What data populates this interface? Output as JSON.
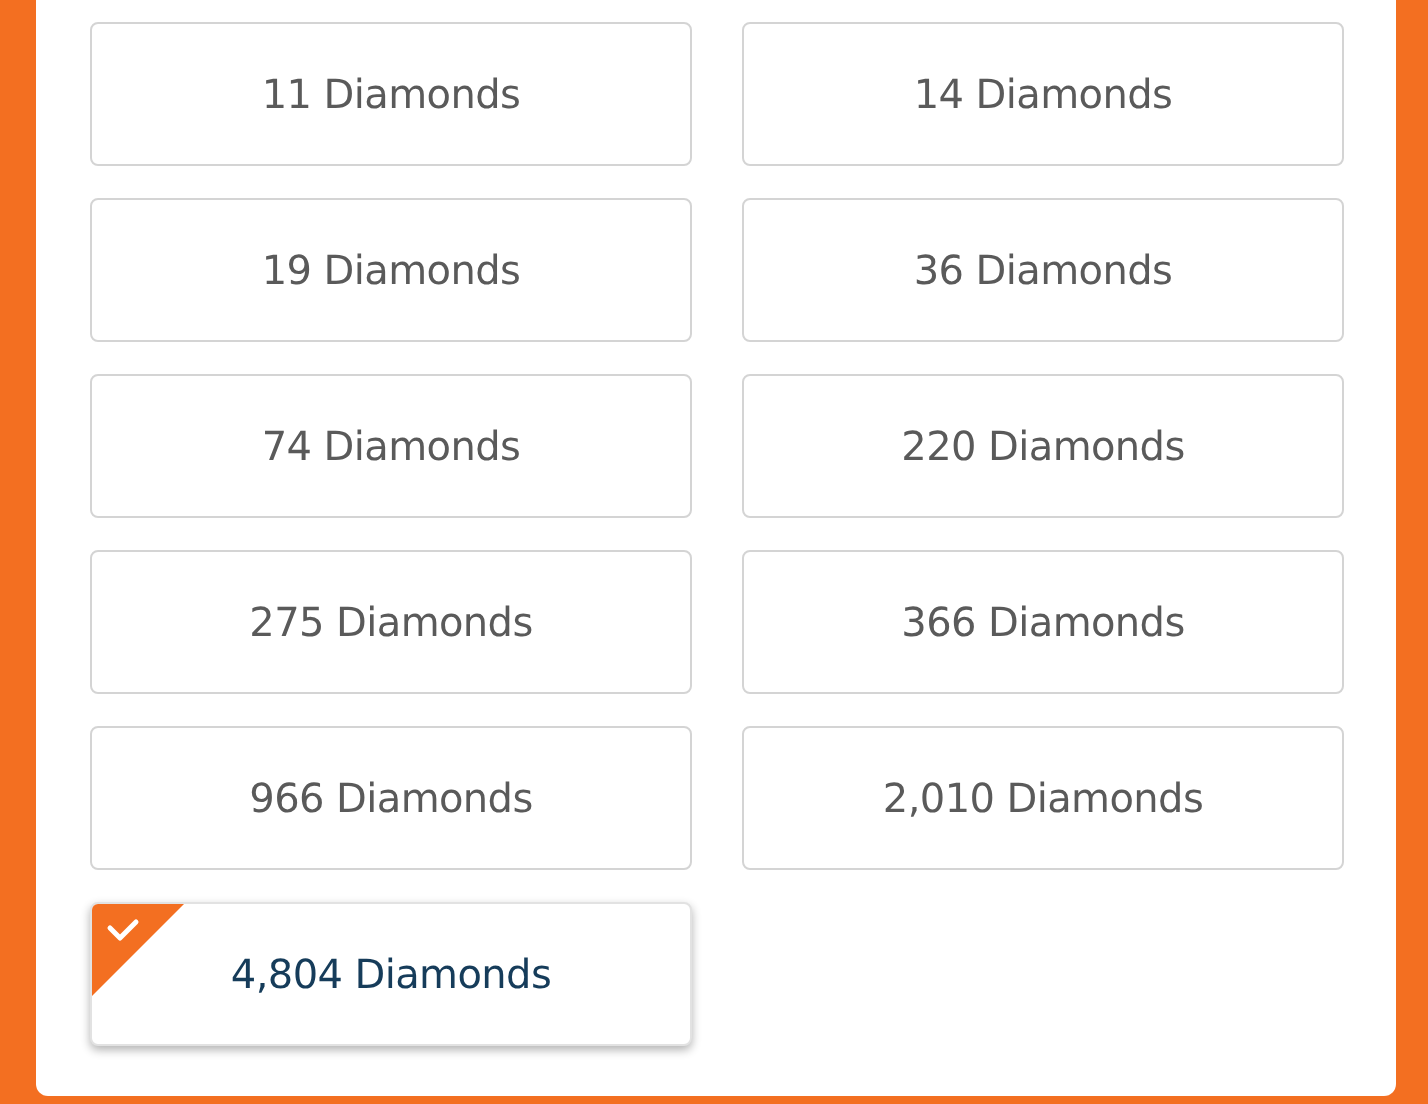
{
  "options": [
    {
      "label": "11 Diamonds",
      "selected": false
    },
    {
      "label": "14 Diamonds",
      "selected": false
    },
    {
      "label": "19 Diamonds",
      "selected": false
    },
    {
      "label": "36 Diamonds",
      "selected": false
    },
    {
      "label": "74 Diamonds",
      "selected": false
    },
    {
      "label": "220 Diamonds",
      "selected": false
    },
    {
      "label": "275 Diamonds",
      "selected": false
    },
    {
      "label": "366 Diamonds",
      "selected": false
    },
    {
      "label": "966 Diamonds",
      "selected": false
    },
    {
      "label": "2,010 Diamonds",
      "selected": false
    },
    {
      "label": "4,804 Diamonds",
      "selected": true
    }
  ]
}
